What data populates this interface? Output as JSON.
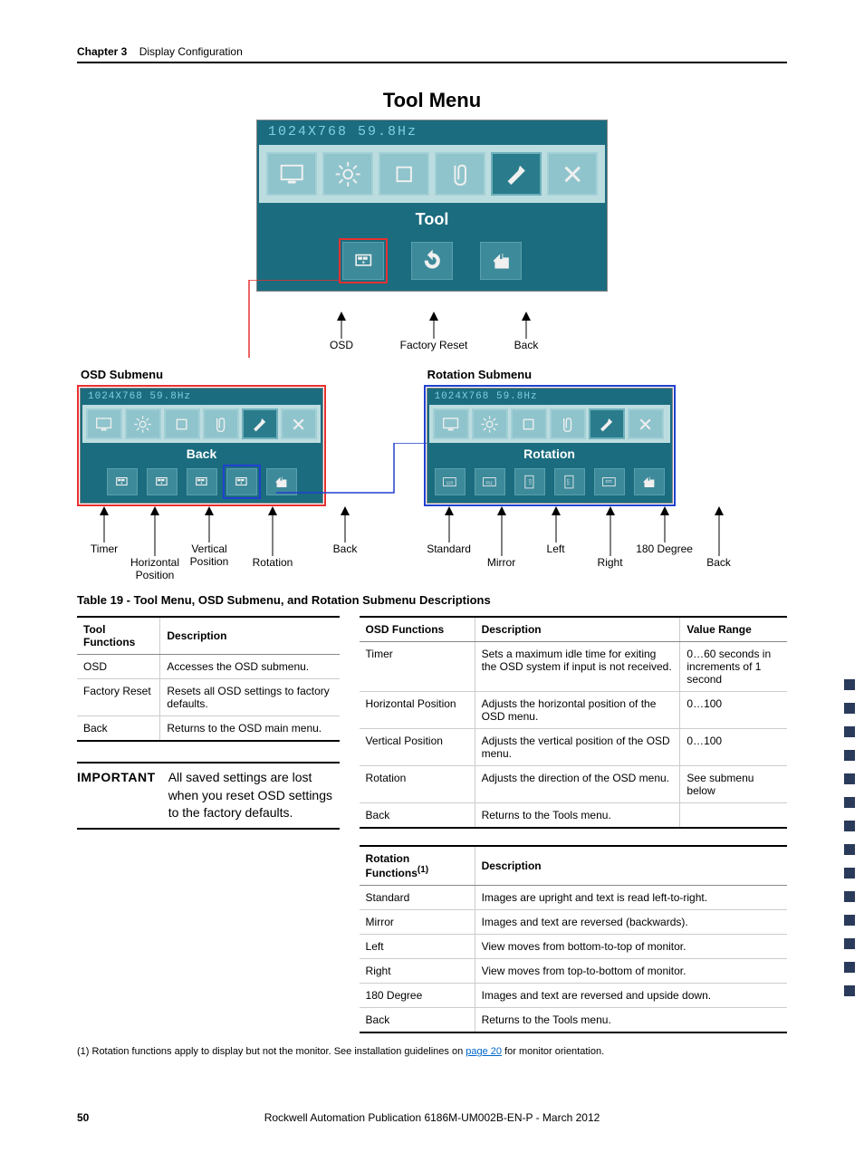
{
  "chapter": {
    "title": "Chapter 3",
    "subtitle": "Display Configuration"
  },
  "page_title": "Tool Menu",
  "osd_main": {
    "resolution": "1024X768   59.8Hz",
    "label": "Tool",
    "callouts": {
      "c1": "OSD",
      "c2": "Factory Reset",
      "c3": "Back"
    }
  },
  "osd_sub_title": "OSD Submenu",
  "rotation_sub_title": "Rotation Submenu",
  "osd_sub": {
    "resolution": "1024X768   59.8Hz",
    "label": "Back",
    "callouts": {
      "c1": "Timer",
      "c2": "Horizontal Position",
      "c3": "Vertical Position",
      "c4": "Rotation",
      "c5": "Back"
    }
  },
  "rot_sub": {
    "resolution": "1024X768   59.8Hz",
    "label": "Rotation",
    "callouts": {
      "c1": "Standard",
      "c2": "Mirror",
      "c3": "Left",
      "c4": "Right",
      "c5": "180 Degree",
      "c6": "Back"
    }
  },
  "table_caption": "Table 19 - Tool Menu, OSD Submenu, and Rotation Submenu Descriptions",
  "tool_table": {
    "h1": "Tool Functions",
    "h2": "Description",
    "rows": [
      {
        "f": "OSD",
        "d": "Accesses the OSD submenu."
      },
      {
        "f": "Factory Reset",
        "d": "Resets all OSD settings to factory defaults."
      },
      {
        "f": "Back",
        "d": "Returns to the OSD main menu."
      }
    ]
  },
  "important": {
    "label": "IMPORTANT",
    "text": "All saved settings are lost when you reset OSD settings to the factory defaults."
  },
  "osd_table": {
    "h1": "OSD Functions",
    "h2": "Description",
    "h3": "Value Range",
    "rows": [
      {
        "f": "Timer",
        "d": "Sets a maximum idle time for exiting the OSD system if input is not received.",
        "v": "0…60 seconds in increments of 1 second"
      },
      {
        "f": "Horizontal Position",
        "d": "Adjusts the horizontal position of the OSD menu.",
        "v": "0…100"
      },
      {
        "f": "Vertical Position",
        "d": "Adjusts the vertical position of the OSD menu.",
        "v": "0…100"
      },
      {
        "f": "Rotation",
        "d": "Adjusts the direction of the OSD menu.",
        "v": "See submenu below"
      },
      {
        "f": "Back",
        "d": "Returns to the Tools menu.",
        "v": ""
      }
    ]
  },
  "rot_table": {
    "h1": "Rotation Functions",
    "sup": "(1)",
    "h2": "Description",
    "rows": [
      {
        "f": "Standard",
        "d": "Images are upright and text is read left-to-right."
      },
      {
        "f": "Mirror",
        "d": "Images and text are reversed (backwards)."
      },
      {
        "f": "Left",
        "d": "View moves from bottom-to-top of monitor."
      },
      {
        "f": "Right",
        "d": "View moves from top-to-bottom of monitor."
      },
      {
        "f": "180 Degree",
        "d": "Images and text are reversed and upside down."
      },
      {
        "f": "Back",
        "d": "Returns to the Tools menu."
      }
    ]
  },
  "footnote": {
    "pre": "(1)   Rotation functions apply to display but not the monitor. See installation guidelines on ",
    "link": "page 20",
    "post": " for monitor orientation."
  },
  "footer": {
    "page": "50",
    "pub": "Rockwell Automation Publication 6186M-UM002B-EN-P - March 2012"
  }
}
